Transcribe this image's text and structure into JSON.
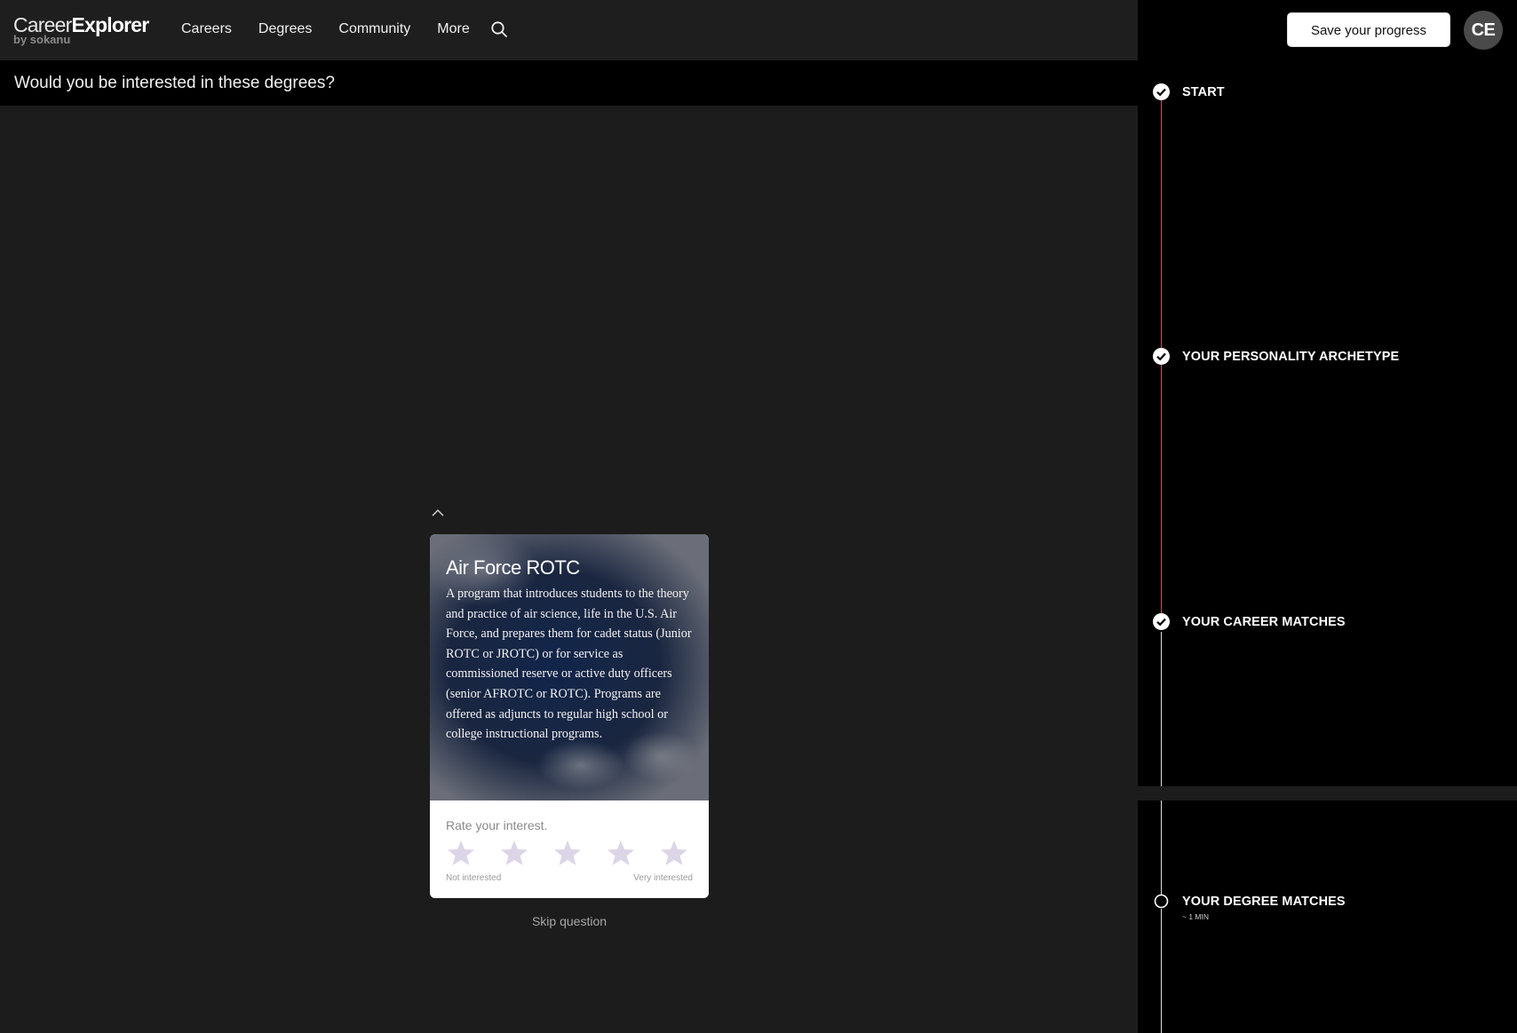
{
  "header": {
    "logo_light": "Career",
    "logo_bold": "Explorer",
    "logo_sub": "by sokanu",
    "nav": [
      "Careers",
      "Degrees",
      "Community",
      "More"
    ],
    "search_icon": "search-icon"
  },
  "question": {
    "text": "Would you be interested in these degrees?"
  },
  "card": {
    "title": "Air Force ROTC",
    "description": "A program that introduces students to the theory and practice of air science, life in the U.S. Air Force, and prepares them for cadet status (Junior ROTC or JROTC) or for service as commissioned reserve or active duty officers (senior AFROTC or ROTC). Programs are offered as adjuncts to regular high school or college instructional programs.",
    "rate_label": "Rate your interest.",
    "rating": 0,
    "max_rating": 5,
    "scale_low": "Not interested",
    "scale_high": "Very interested",
    "star_color": "#d9d2e6"
  },
  "skip_label": "Skip question",
  "sidebar": {
    "save_button": "Save your progress",
    "avatar_initials": "CE",
    "steps": [
      {
        "label": "START",
        "status": "complete"
      },
      {
        "label": "YOUR PERSONALITY ARCHETYPE",
        "status": "complete"
      },
      {
        "label": "YOUR CAREER MATCHES",
        "status": "complete"
      },
      {
        "label": "YOUR DEGREE MATCHES",
        "status": "current",
        "sub": "~ 1 MIN"
      }
    ],
    "progress_color": "#c8505a"
  }
}
